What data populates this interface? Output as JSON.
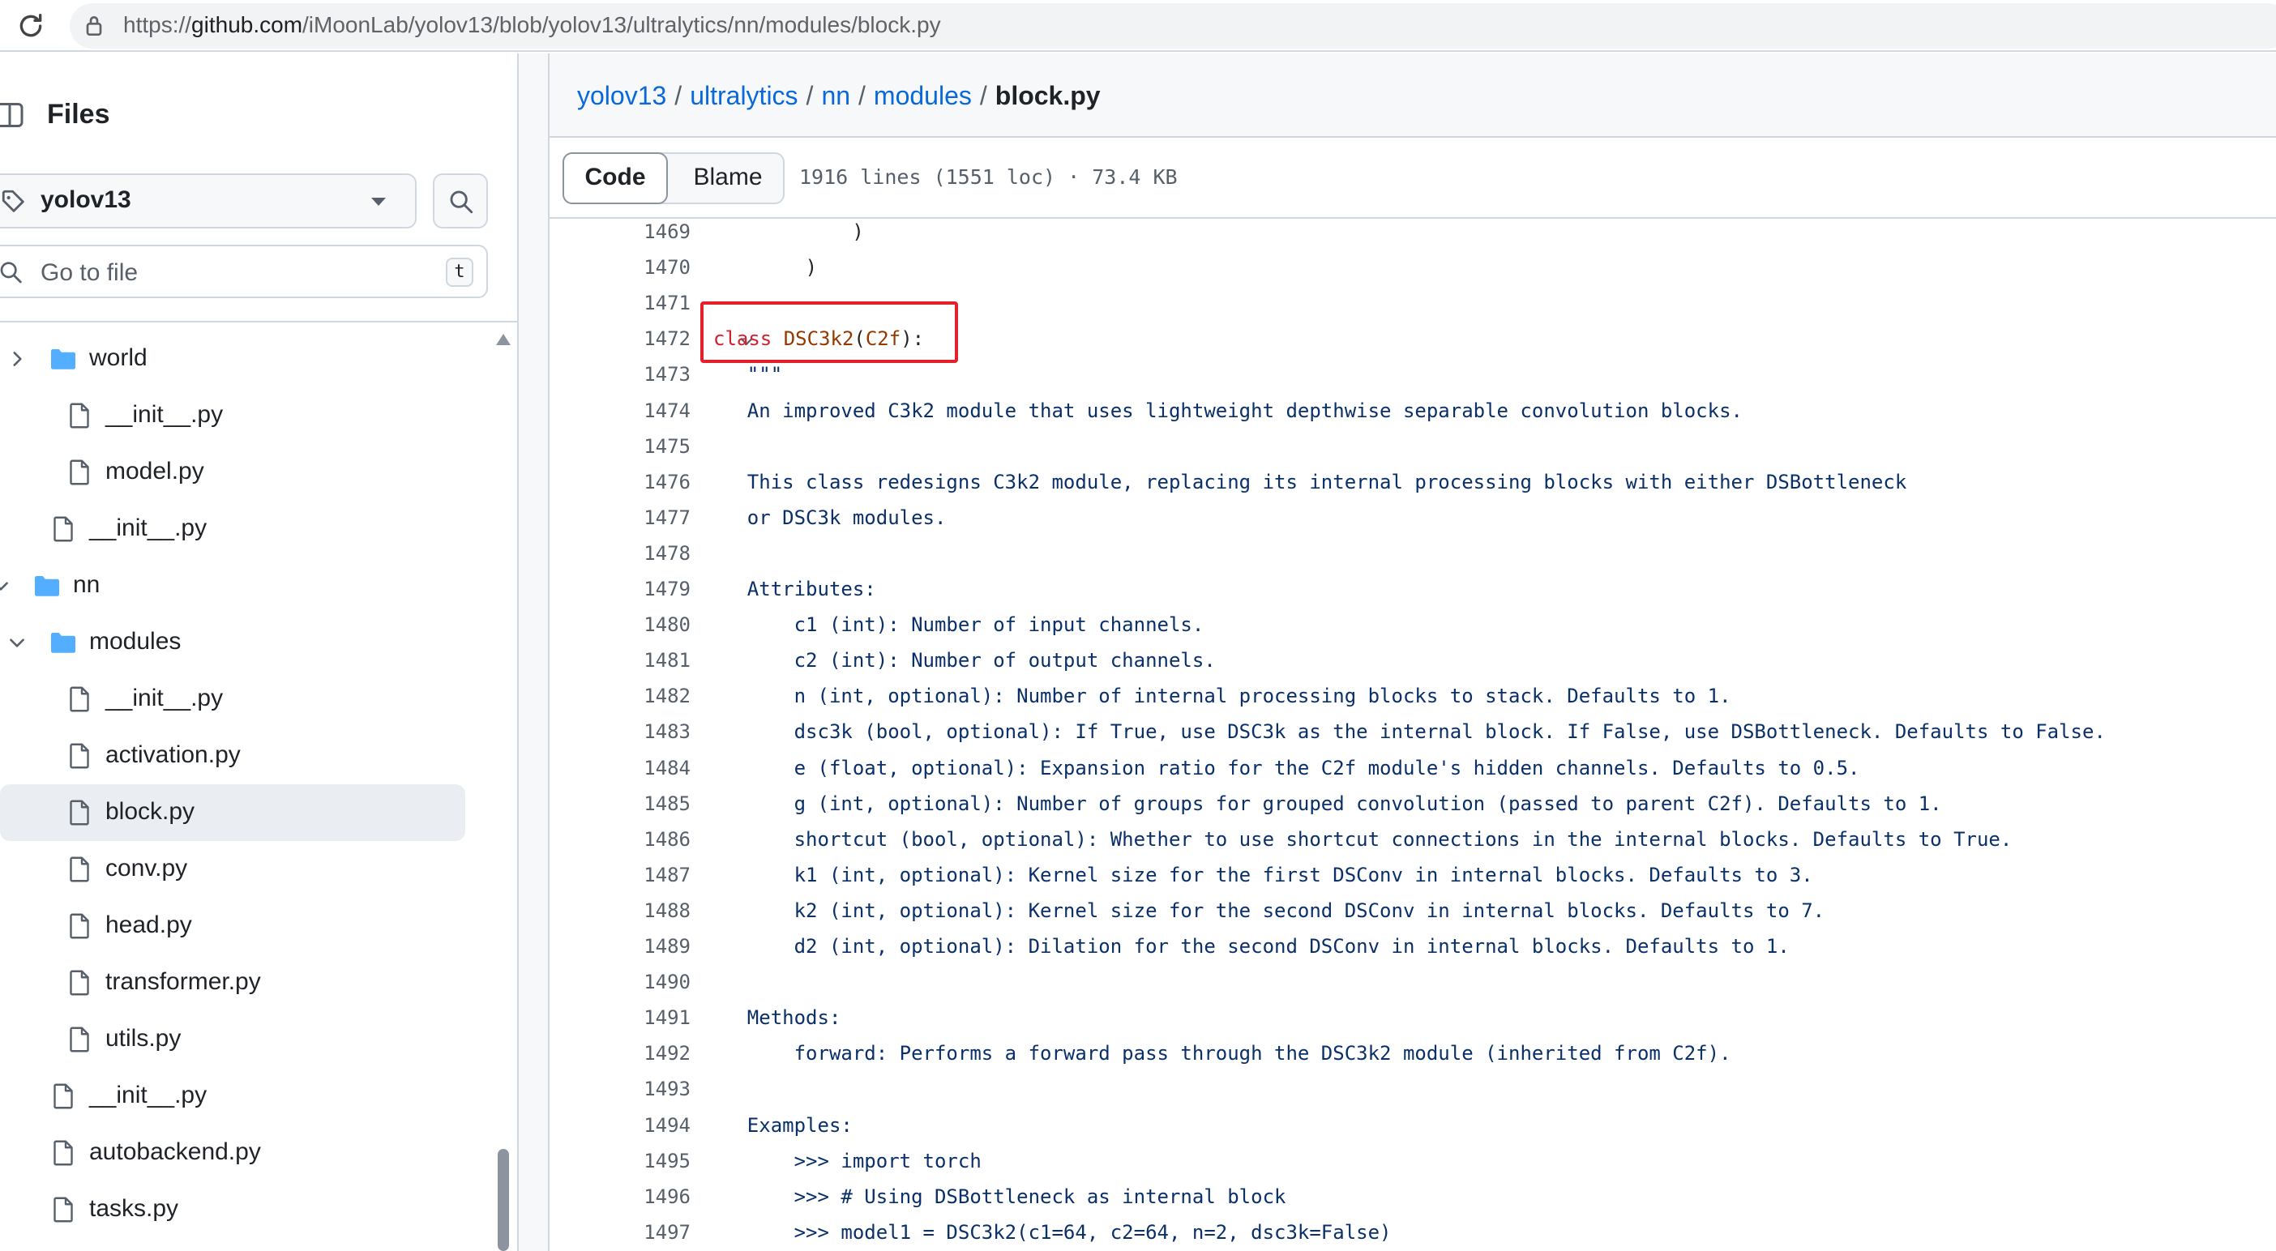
{
  "browser": {
    "url_prefix": "https://",
    "url_host": "github.com",
    "url_path": "/iMoonLab/yolov13/blob/yolov13/ultralytics/nn/modules/block.py"
  },
  "sidebar": {
    "title": "Files",
    "branch": "yolov13",
    "goto_placeholder": "Go to file",
    "goto_shortcut": "t",
    "tree": [
      {
        "label": "world",
        "type": "folder",
        "depth": 2,
        "expanded": false
      },
      {
        "label": "__init__.py",
        "type": "file",
        "depth": 3
      },
      {
        "label": "model.py",
        "type": "file",
        "depth": 3
      },
      {
        "label": "__init__.py",
        "type": "file",
        "depth": 2
      },
      {
        "label": "nn",
        "type": "folder",
        "depth": 1,
        "expanded": true
      },
      {
        "label": "modules",
        "type": "folder",
        "depth": 2,
        "expanded": true
      },
      {
        "label": "__init__.py",
        "type": "file",
        "depth": 3
      },
      {
        "label": "activation.py",
        "type": "file",
        "depth": 3
      },
      {
        "label": "block.py",
        "type": "file",
        "depth": 3,
        "selected": true
      },
      {
        "label": "conv.py",
        "type": "file",
        "depth": 3
      },
      {
        "label": "head.py",
        "type": "file",
        "depth": 3
      },
      {
        "label": "transformer.py",
        "type": "file",
        "depth": 3
      },
      {
        "label": "utils.py",
        "type": "file",
        "depth": 3
      },
      {
        "label": "__init__.py",
        "type": "file",
        "depth": 2
      },
      {
        "label": "autobackend.py",
        "type": "file",
        "depth": 2
      },
      {
        "label": "tasks.py",
        "type": "file",
        "depth": 2
      }
    ]
  },
  "main": {
    "breadcrumb": [
      "yolov13",
      "ultralytics",
      "nn",
      "modules"
    ],
    "breadcrumb_file": "block.py",
    "tabs": {
      "code": "Code",
      "blame": "Blame"
    },
    "file_meta": "1916 lines (1551 loc) · 73.4 KB",
    "lines": [
      {
        "n": "1469",
        "text": "            )",
        "kind": "code"
      },
      {
        "n": "1470",
        "text": "        )",
        "kind": "code"
      },
      {
        "n": "1471",
        "text": "",
        "kind": "code"
      },
      {
        "n": "1472",
        "text": "",
        "kind": "class",
        "fold": true
      },
      {
        "n": "1473",
        "text": "    \"\"\"",
        "kind": "doc"
      },
      {
        "n": "1474",
        "text": "    An improved C3k2 module that uses lightweight depthwise separable convolution blocks.",
        "kind": "doc"
      },
      {
        "n": "1475",
        "text": "",
        "kind": "doc"
      },
      {
        "n": "1476",
        "text": "    This class redesigns C3k2 module, replacing its internal processing blocks with either DSBottleneck",
        "kind": "doc"
      },
      {
        "n": "1477",
        "text": "    or DSC3k modules.",
        "kind": "doc"
      },
      {
        "n": "1478",
        "text": "",
        "kind": "doc"
      },
      {
        "n": "1479",
        "text": "    Attributes:",
        "kind": "doc"
      },
      {
        "n": "1480",
        "text": "        c1 (int): Number of input channels.",
        "kind": "doc"
      },
      {
        "n": "1481",
        "text": "        c2 (int): Number of output channels.",
        "kind": "doc"
      },
      {
        "n": "1482",
        "text": "        n (int, optional): Number of internal processing blocks to stack. Defaults to 1.",
        "kind": "doc"
      },
      {
        "n": "1483",
        "text": "        dsc3k (bool, optional): If True, use DSC3k as the internal block. If False, use DSBottleneck. Defaults to False.",
        "kind": "doc"
      },
      {
        "n": "1484",
        "text": "        e (float, optional): Expansion ratio for the C2f module's hidden channels. Defaults to 0.5.",
        "kind": "doc"
      },
      {
        "n": "1485",
        "text": "        g (int, optional): Number of groups for grouped convolution (passed to parent C2f). Defaults to 1.",
        "kind": "doc"
      },
      {
        "n": "1486",
        "text": "        shortcut (bool, optional): Whether to use shortcut connections in the internal blocks. Defaults to True.",
        "kind": "doc"
      },
      {
        "n": "1487",
        "text": "        k1 (int, optional): Kernel size for the first DSConv in internal blocks. Defaults to 3.",
        "kind": "doc"
      },
      {
        "n": "1488",
        "text": "        k2 (int, optional): Kernel size for the second DSConv in internal blocks. Defaults to 7.",
        "kind": "doc"
      },
      {
        "n": "1489",
        "text": "        d2 (int, optional): Dilation for the second DSConv in internal blocks. Defaults to 1.",
        "kind": "doc"
      },
      {
        "n": "1490",
        "text": "",
        "kind": "doc"
      },
      {
        "n": "1491",
        "text": "    Methods:",
        "kind": "doc"
      },
      {
        "n": "1492",
        "text": "        forward: Performs a forward pass through the DSC3k2 module (inherited from C2f).",
        "kind": "doc"
      },
      {
        "n": "1493",
        "text": "",
        "kind": "doc"
      },
      {
        "n": "1494",
        "text": "    Examples:",
        "kind": "doc"
      },
      {
        "n": "1495",
        "text": "        >>> import torch",
        "kind": "doc"
      },
      {
        "n": "1496",
        "text": "        >>> # Using DSBottleneck as internal block",
        "kind": "doc"
      },
      {
        "n": "1497",
        "text": "        >>> model1 = DSC3k2(c1=64, c2=64, n=2, dsc3k=False)",
        "kind": "doc"
      }
    ],
    "class_line": {
      "keyword": "class",
      "name": "DSC3k2",
      "open": "(",
      "base": "C2f",
      "close": "):"
    }
  }
}
